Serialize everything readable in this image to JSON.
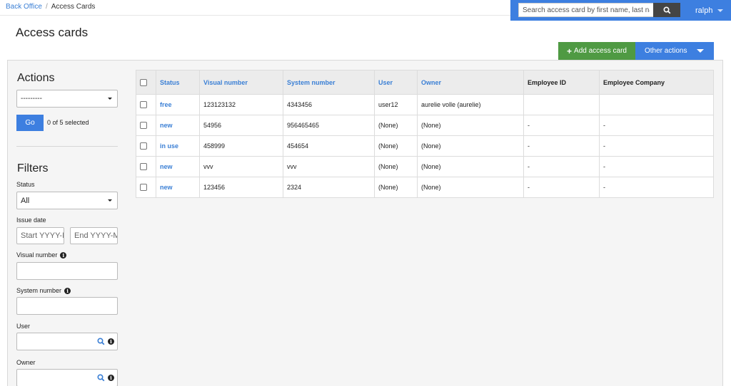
{
  "breadcrumb": {
    "home": "Back Office",
    "separator": "/",
    "current": "Access Cards"
  },
  "search": {
    "placeholder": "Search access card by first name, last name",
    "icon": "search-icon"
  },
  "user_menu": {
    "label": "ralph"
  },
  "page": {
    "title": "Access cards"
  },
  "toolbar": {
    "add_label": "Add access card",
    "add_icon": "+",
    "other_label": "Other actions"
  },
  "colors": {
    "accent": "#3d7fe0",
    "success": "#4f9a43",
    "link": "#3a7fd5"
  },
  "sidebar": {
    "actions_title": "Actions",
    "action_select": "---------",
    "go_label": "Go",
    "selected_count": "0 of 5 selected",
    "filters_title": "Filters",
    "status_label": "Status",
    "status_value": "All",
    "issue_date_label": "Issue date",
    "issue_start_placeholder": "Start YYYY-MM-DD",
    "issue_end_placeholder": "End YYYY-MM-DD",
    "visual_number_label": "Visual number",
    "system_number_label": "System number",
    "user_label": "User",
    "owner_label": "Owner"
  },
  "table": {
    "columns": [
      "Status",
      "Visual number",
      "System number",
      "User",
      "Owner",
      "Employee ID",
      "Employee Company"
    ],
    "rows": [
      {
        "status": "free",
        "visual": "123123132",
        "system": "4343456",
        "user": "user12",
        "owner": "aurelie volle (aurelie)",
        "employee_id": "",
        "employee_company": ""
      },
      {
        "status": "new",
        "visual": "54956",
        "system": "956465465",
        "user": "(None)",
        "owner": "(None)",
        "employee_id": "-",
        "employee_company": "-"
      },
      {
        "status": "in use",
        "visual": "458999",
        "system": "454654",
        "user": "(None)",
        "owner": "(None)",
        "employee_id": "-",
        "employee_company": "-"
      },
      {
        "status": "new",
        "visual": "vvv",
        "system": "vvv",
        "user": "(None)",
        "owner": "(None)",
        "employee_id": "-",
        "employee_company": "-"
      },
      {
        "status": "new",
        "visual": "123456",
        "system": "2324",
        "user": "(None)",
        "owner": "(None)",
        "employee_id": "-",
        "employee_company": "-"
      }
    ]
  }
}
